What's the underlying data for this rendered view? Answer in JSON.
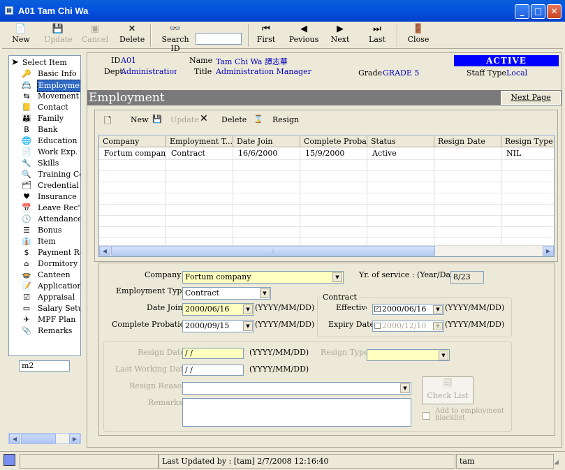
{
  "window": {
    "title": "A01 Tam Chi Wa"
  },
  "toolbar": {
    "new": "New",
    "update": "Update",
    "cancel": "Cancel",
    "delete": "Delete",
    "search_label": "Search ID",
    "search_value": "",
    "first": "First",
    "previous": "Pevious",
    "next": "Next",
    "last": "Last",
    "close": "Close"
  },
  "tree": {
    "root": "Select Item",
    "items": [
      {
        "label": "Basic Info",
        "icon": "key-icon",
        "glyph": "🔑"
      },
      {
        "label": "Employment",
        "icon": "employment-icon",
        "glyph": "📇"
      },
      {
        "label": "Movement",
        "icon": "movement-icon",
        "glyph": "⇆"
      },
      {
        "label": "Contact",
        "icon": "contact-icon",
        "glyph": "📒"
      },
      {
        "label": "Family",
        "icon": "family-icon",
        "glyph": "👪"
      },
      {
        "label": "Bank",
        "icon": "bank-icon",
        "glyph": "B"
      },
      {
        "label": "Education",
        "icon": "education-icon",
        "glyph": "🌐"
      },
      {
        "label": "Work Exp.",
        "icon": "work-icon",
        "glyph": "📄"
      },
      {
        "label": "Skills",
        "icon": "skills-icon",
        "glyph": "🔧"
      },
      {
        "label": "Training Cou",
        "icon": "training-icon",
        "glyph": "🔍"
      },
      {
        "label": "Credential",
        "icon": "credential-icon",
        "glyph": "🗂"
      },
      {
        "label": "Insurance",
        "icon": "heart-icon",
        "glyph": "♥"
      },
      {
        "label": "Leave Rec'",
        "icon": "leave-icon",
        "glyph": "📅"
      },
      {
        "label": "Attendance",
        "icon": "clock-icon",
        "glyph": "🕓"
      },
      {
        "label": "Bonus",
        "icon": "bonus-icon",
        "glyph": "☰"
      },
      {
        "label": "Item",
        "icon": "item-icon",
        "glyph": "👔"
      },
      {
        "label": "Payment Rec'",
        "icon": "dollar-icon",
        "glyph": "$"
      },
      {
        "label": "Dormitory",
        "icon": "house-icon",
        "glyph": "⌂"
      },
      {
        "label": "Canteen",
        "icon": "canteen-icon",
        "glyph": "🍲"
      },
      {
        "label": "Application",
        "icon": "application-icon",
        "glyph": "📝"
      },
      {
        "label": "Appraisal",
        "icon": "check-icon",
        "glyph": "☑"
      },
      {
        "label": "Salary Setup",
        "icon": "salary-icon",
        "glyph": "▭"
      },
      {
        "label": "MPF Plan",
        "icon": "mpf-icon",
        "glyph": "✈"
      },
      {
        "label": "Remarks",
        "icon": "clip-icon",
        "glyph": "📎"
      }
    ],
    "selected": 1,
    "search_value": "m2"
  },
  "header": {
    "id_label": "ID",
    "id_value": "A01",
    "dept_label": "Dept",
    "dept_value": "Administration Department",
    "name_label": "Name",
    "name_value": "Tam Chi Wa  譚志華",
    "title_label": "Title",
    "title_value": "Administration Manager",
    "grade_label": "Grade",
    "grade_value": "GRADE 5",
    "status": "ACTIVE",
    "staff_type_label": "Staff Type",
    "staff_type_value": "Local"
  },
  "section": {
    "title": "Employment",
    "next_page": "Next Page"
  },
  "subtoolbar": {
    "new": "New",
    "update": "Update",
    "delete": "Delete",
    "resign": "Resign"
  },
  "grid": {
    "columns": [
      "Company",
      "Employment T...",
      "Date Join",
      "Complete Proba...",
      "Status",
      "Resign Date",
      "Resign Type"
    ],
    "rows": [
      [
        "Fortum company",
        "Contract",
        "16/6/2000",
        "15/9/2000",
        "Active",
        "",
        "NIL"
      ]
    ]
  },
  "form": {
    "company_label": "Company",
    "company_value": "Fortum company",
    "years_label": "Yr. of service : (Year/Day)",
    "years_value": "8/23",
    "emp_type_label": "Employment Type",
    "emp_type_value": "Contract",
    "date_join_label": "Date Join",
    "date_join_value": "2000/06/16",
    "complete_prob_label": "Complete Probation",
    "complete_prob_value": "2000/09/15",
    "date_format": "(YYYY/MM/DD)",
    "contract_group": "Contract",
    "effective_label": "Effective Date",
    "effective_value": "2000/06/16",
    "expiry_label": "Expiry Date",
    "expiry_value": "2000/12/10",
    "resign_date_label": "Resign Date",
    "resign_date_value": " / /",
    "resign_type_label": "Resign Type",
    "resign_type_value": "",
    "last_working_label": "Last Working Date",
    "last_working_value": " / /",
    "resign_reason_label": "Resign Reason",
    "resign_reason_value": "",
    "remarks_label": "Remarks",
    "remarks_value": "",
    "check_list": "Check List",
    "blacklist_label": "Add to employment blacklist"
  },
  "status": {
    "updated": "Last Updated by : [tam]  2/7/2008 12:16:40",
    "user": "tam"
  },
  "colors": {
    "title_blue": "#0454e0",
    "section_gray": "#7a7a7a",
    "active_bg": "#0000ff",
    "selected": "#316ac5",
    "field_yellow": "#ffffc0"
  }
}
